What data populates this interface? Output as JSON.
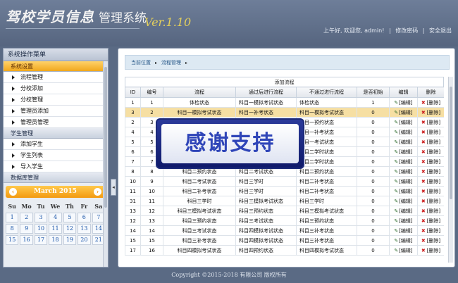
{
  "header": {
    "logo_main": "驾校学员信息",
    "logo_sub": "管理系统",
    "version": "Ver.1.10",
    "greeting": "上午好, 欢迎您, admin!",
    "change_password": "修改密码",
    "separator": "|",
    "logout": "安全退出"
  },
  "sidebar": {
    "title": "系统操作菜单",
    "sections": [
      {
        "label": "系统设置",
        "active": true,
        "items": [
          "流程管理",
          "分校添加",
          "分校管理",
          "管理员添加",
          "管理员管理"
        ]
      },
      {
        "label": "学生管理",
        "active": false,
        "items": [
          "添加学生",
          "学生列表",
          "导入学生"
        ]
      },
      {
        "label": "数据库管理",
        "active": false,
        "items": []
      }
    ]
  },
  "calendar": {
    "month_label": "March 2015",
    "prev_label": "‹",
    "next_label": "›",
    "weekdays": [
      "Su",
      "Mo",
      "Tu",
      "We",
      "Th",
      "Fr",
      "Sa"
    ],
    "days": [
      "1",
      "2",
      "3",
      "4",
      "5",
      "6",
      "7",
      "8",
      "9",
      "10",
      "11",
      "12",
      "13",
      "14",
      "15",
      "16",
      "17",
      "18",
      "19",
      "20",
      "21"
    ]
  },
  "breadcrumb": {
    "current_label": "当前位置",
    "page": "流程管理",
    "sep": "▸"
  },
  "table": {
    "title": "添加流程",
    "columns": [
      "ID",
      "编号",
      "流程",
      "通过后进行流程",
      "不通过进行流程",
      "是否初始",
      "编辑",
      "删除"
    ],
    "edit_label": "[编辑]",
    "delete_label": "[删除]",
    "rows": [
      [
        "1",
        "1",
        "体检状态",
        "科目一模拟考试状态",
        "体检状态",
        "1"
      ],
      [
        "3",
        "2",
        "科目一模拟考试状态",
        "科目一补考状态",
        "科目一模拟考试状态",
        "0"
      ],
      [
        "2",
        "3",
        "",
        "",
        "科目一预约状态",
        "0"
      ],
      [
        "4",
        "4",
        "",
        "",
        "科目一补考状态",
        "0"
      ],
      [
        "5",
        "5",
        "",
        "",
        "科目一考试状态",
        "0"
      ],
      [
        "6",
        "6",
        "",
        "",
        "科目二学时状态",
        "0"
      ],
      [
        "7",
        "7",
        "",
        "",
        "科目二学时状态",
        "0"
      ],
      [
        "8",
        "8",
        "科目二预约状态",
        "科目二考试状态",
        "科目二预约状态",
        "0"
      ],
      [
        "10",
        "9",
        "科目二考试状态",
        "科目三学时",
        "科目二补考状态",
        "0"
      ],
      [
        "11",
        "10",
        "科目二补考状态",
        "科目三学时",
        "科目二补考状态",
        "0"
      ],
      [
        "31",
        "11",
        "科目三学时",
        "科目三模拟考试状态",
        "科目三学时",
        "0"
      ],
      [
        "13",
        "12",
        "科目三模拟考试状态",
        "科目三预约状态",
        "科目三模拟考试状态",
        "0"
      ],
      [
        "12",
        "13",
        "科目三预约状态",
        "科目三考试状态",
        "科目三预约状态",
        "0"
      ],
      [
        "14",
        "14",
        "科目三考试状态",
        "科目四模拟考试状态",
        "科目三补考状态",
        "0"
      ],
      [
        "15",
        "15",
        "科目三补考状态",
        "科目四模拟考试状态",
        "科目三补考状态",
        "0"
      ],
      [
        "17",
        "16",
        "科目四模拟考试状态",
        "科目四预约状态",
        "科目四模拟考试状态",
        "0"
      ]
    ]
  },
  "overlay_text": "感谢支持",
  "footer": "Copyright ©2015-2018 有限公司 版权所有",
  "colors": {
    "header_bg": "#56657f",
    "active_section": "#f0a71c",
    "highlight_row": "#f6dfa3",
    "overlay_border": "#1c2a7a",
    "overlay_text": "#2f45b8"
  }
}
